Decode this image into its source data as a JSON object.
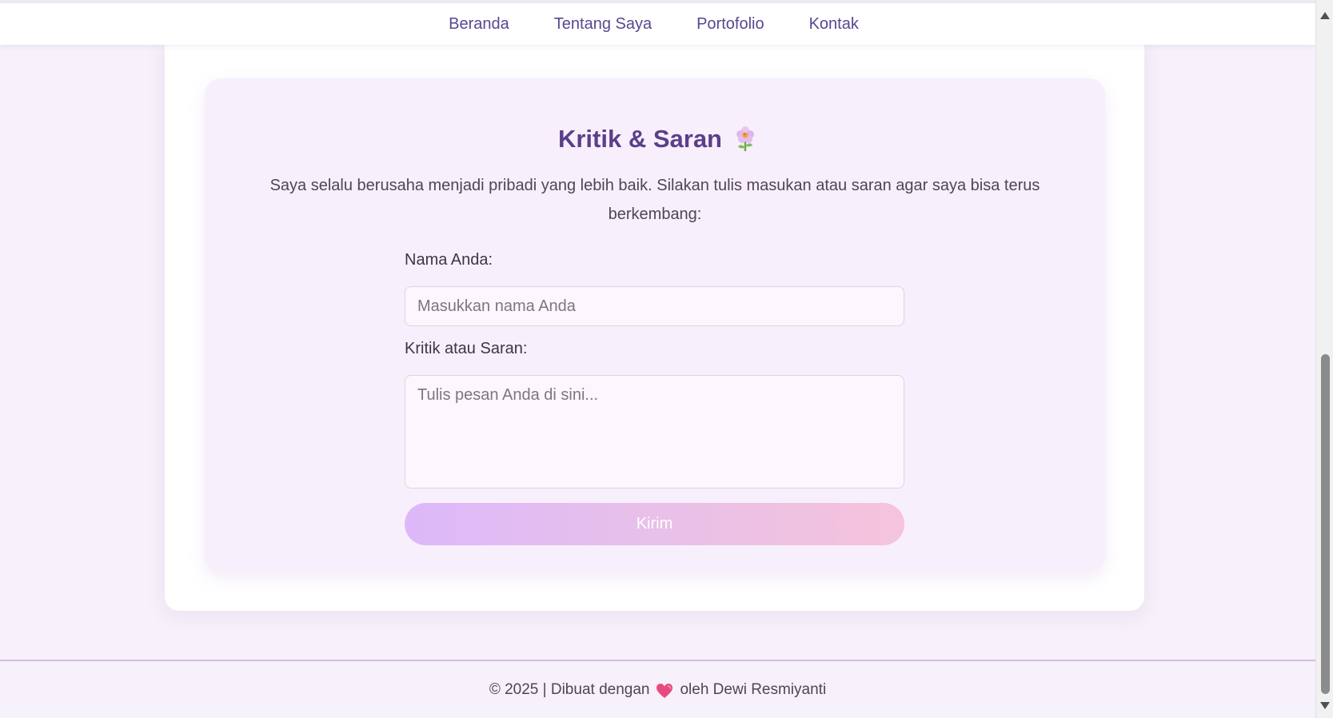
{
  "nav": {
    "items": [
      {
        "label": "Beranda"
      },
      {
        "label": "Tentang Saya"
      },
      {
        "label": "Portofolio"
      },
      {
        "label": "Kontak"
      }
    ]
  },
  "feedback": {
    "title": "Kritik & Saran",
    "title_icon": "flower-icon",
    "intro": "Saya selalu berusaha menjadi pribadi yang lebih baik. Silakan tulis masukan atau saran agar saya bisa terus berkembang:",
    "name_label": "Nama Anda:",
    "name_placeholder": "Masukkan nama Anda",
    "name_value": "",
    "message_label": "Kritik atau Saran:",
    "message_placeholder": "Tulis pesan Anda di sini...",
    "message_value": "",
    "submit_label": "Kirim"
  },
  "footer": {
    "prefix": "© 2025 | Dibuat dengan",
    "icon": "heart-icon",
    "suffix": "oleh Dewi Resmiyanti"
  },
  "colors": {
    "accent": "#5b3f8a",
    "nav_link": "#5b4690",
    "button_gradient_start": "#dcb8fa",
    "button_gradient_end": "#f5c3dc",
    "card_bg": "#f8effd"
  }
}
